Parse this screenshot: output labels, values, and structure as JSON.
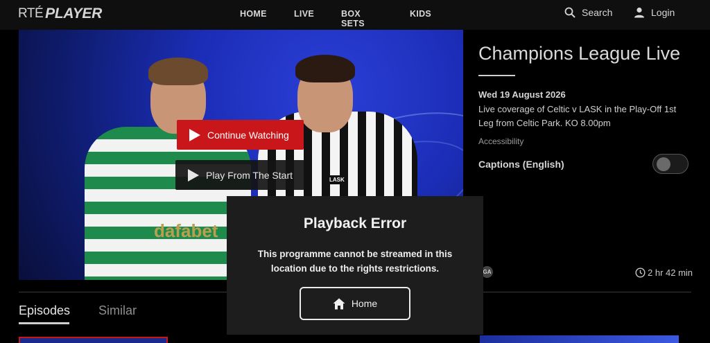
{
  "header": {
    "logo_text_rte": "RTÉ",
    "logo_text_player": "PLAYER",
    "nav": [
      {
        "label": "HOME"
      },
      {
        "label": "LIVE"
      },
      {
        "label": "BOX SETS"
      },
      {
        "label": "KIDS"
      }
    ],
    "search_label": "Search",
    "login_label": "Login"
  },
  "hero": {
    "continue_label": "Continue Watching",
    "start_label": "Play From The Start",
    "jersey_text": "dafabet",
    "badge_text": "LASK"
  },
  "details": {
    "title": "Champions League Live",
    "date": "Wed 19 August 2026",
    "description": "Live coverage of Celtic v LASK in the Play-Off 1st Leg from Celtic Park. KO 8.00pm",
    "accessibility_label": "Accessibility",
    "captions_label": "Captions (English)",
    "captions_on": false,
    "rating_badge": "GA",
    "duration": "2 hr 42 min"
  },
  "tabs": [
    {
      "label": "Episodes",
      "active": true
    },
    {
      "label": "Similar",
      "active": false
    }
  ],
  "modal": {
    "title": "Playback Error",
    "message": "This programme cannot be streamed in this location due to the rights restrictions.",
    "button_label": "Home"
  },
  "colors": {
    "accent": "#c9161b",
    "background": "#000000",
    "header": "#0f0f0f",
    "modal": "#1d1d1d"
  }
}
